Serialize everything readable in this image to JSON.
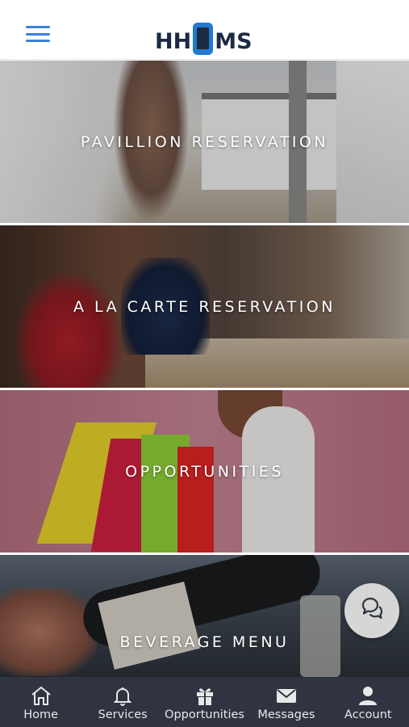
{
  "header": {
    "logo_text_left": "HH",
    "logo_text_right": "MS",
    "menu_icon": "hamburger-icon",
    "accent_color": "#3b82d6"
  },
  "tiles": [
    {
      "label": "PAVILLION RESERVATION"
    },
    {
      "label": "A LA CARTE RESERVATION"
    },
    {
      "label": "OPPORTUNITIES"
    },
    {
      "label": "BEVERAGE MENU"
    }
  ],
  "chat": {
    "icon": "chat-bubbles-icon"
  },
  "tabbar": {
    "background": "#2f3440",
    "items": [
      {
        "label": "Home",
        "icon": "home-icon"
      },
      {
        "label": "Services",
        "icon": "bell-icon"
      },
      {
        "label": "Opportunities",
        "icon": "gift-icon"
      },
      {
        "label": "Messages",
        "icon": "envelope-icon"
      },
      {
        "label": "Account",
        "icon": "user-icon"
      }
    ]
  }
}
